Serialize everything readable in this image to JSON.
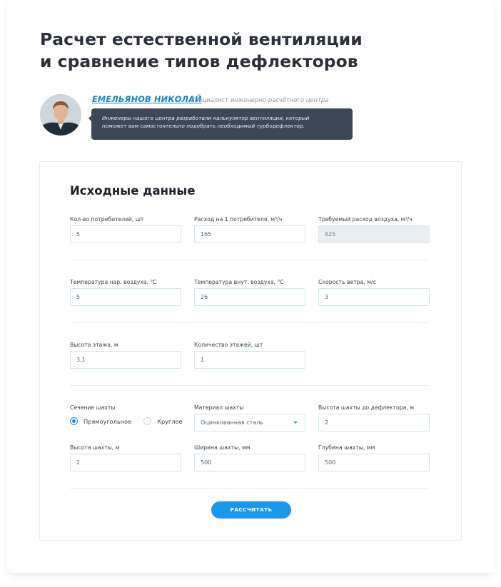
{
  "page": {
    "title_line1": "Расчет естественной вентиляции",
    "title_line2": "и сравнение типов дефлекторов"
  },
  "author": {
    "name": "ЕМЕЛЬЯНОВ НИКОЛАЙ",
    "role": "Специалист инженерно-расчётного центра",
    "quote_line1": "Инженеры нашего центра разработали калькулятор вентиляции, который",
    "quote_line2": "поможет вам самостоятельно подобрать необходимый турбодефлектор."
  },
  "form": {
    "section_title": "Исходные данные",
    "consumers": {
      "label": "Кол-во потребителей, шт",
      "value": "5"
    },
    "flow_per_consumer": {
      "label": "Расход на 1 потребителя, м³/ч",
      "value": "165"
    },
    "required_flow": {
      "label": "Требуемый расход воздуха, м³/ч",
      "value": "825"
    },
    "outdoor_temp": {
      "label": "Температура нар. воздуха, °С",
      "value": "5"
    },
    "indoor_temp": {
      "label": "Температура внут. воздуха, °С",
      "value": "26"
    },
    "wind_speed": {
      "label": "Скорость ветра, м/с",
      "value": "3"
    },
    "floor_height": {
      "label": "Высота этажа, м",
      "value": "3,1"
    },
    "floors_count": {
      "label": "Количество этажей, шт",
      "value": "1"
    },
    "shaft_section": {
      "label": "Сечение шахты",
      "options": [
        "Прямоугольное",
        "Круглое"
      ],
      "selected": "Прямоугольное"
    },
    "shaft_material": {
      "label": "Материал шахты",
      "value": "Оцинкованная сталь"
    },
    "shaft_height_to_deflector": {
      "label": "Высота шахты до дефлектора, м",
      "value": "2"
    },
    "shaft_height": {
      "label": "Высота шахты, м",
      "value": "2"
    },
    "shaft_width": {
      "label": "Ширина шахты, мм",
      "value": "500"
    },
    "shaft_depth": {
      "label": "Глубина шахты, мм",
      "value": "500"
    },
    "submit_label": "РАССЧИТАТЬ"
  },
  "colors": {
    "accent": "#1a96ea",
    "link": "#1a82d2",
    "bubble": "#3e4755"
  },
  "icons": {
    "select_caret": "chevron-down-icon",
    "radio_checked": "radio-checked-icon",
    "radio_unchecked": "radio-unchecked-icon"
  }
}
